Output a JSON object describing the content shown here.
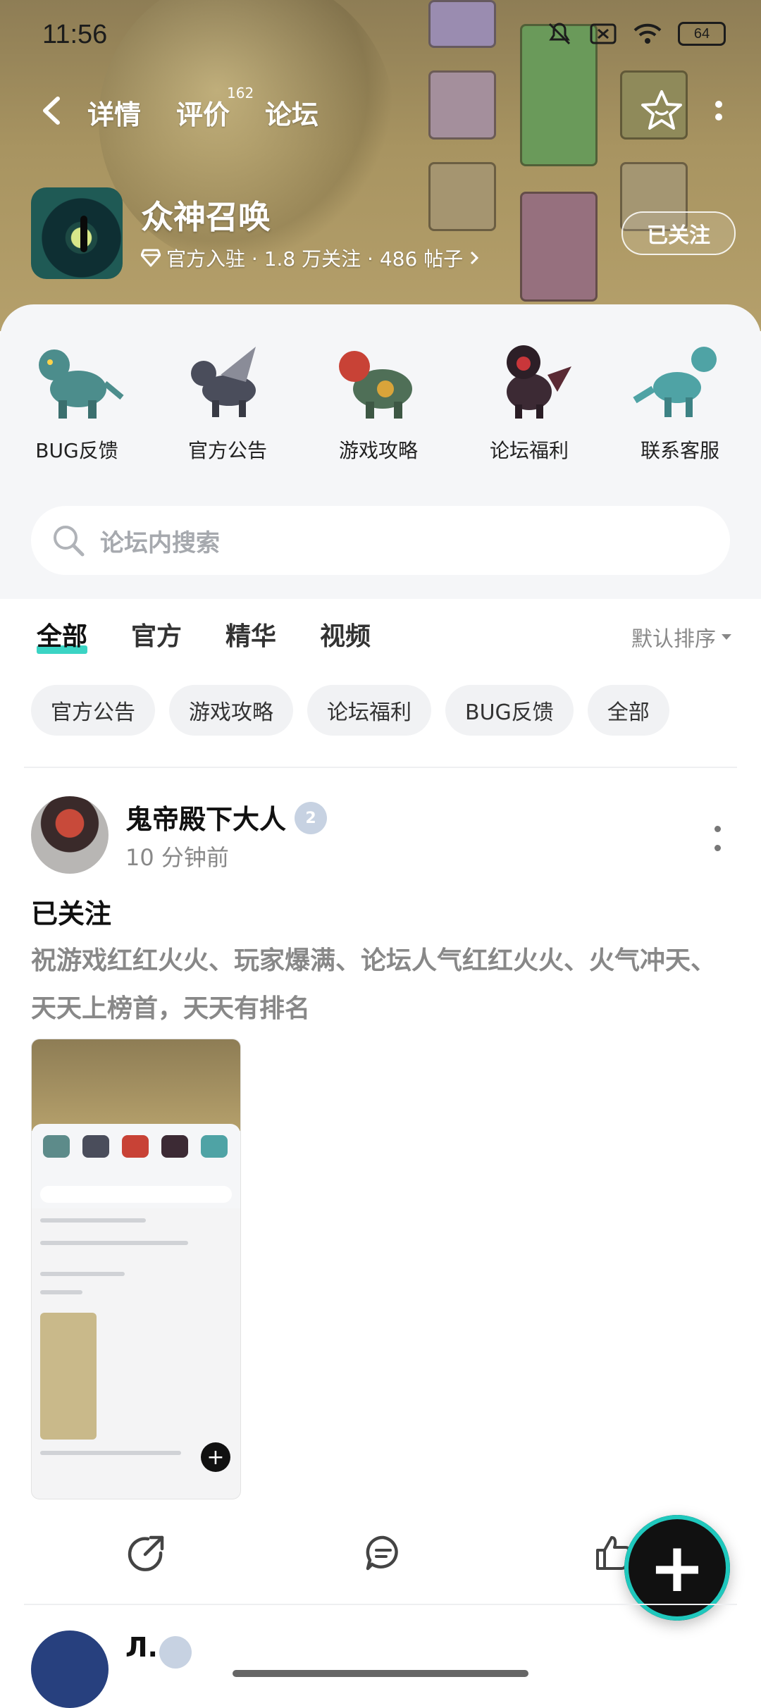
{
  "status_bar": {
    "time": "11:56",
    "battery": "64"
  },
  "nav": {
    "tabs": [
      {
        "label": "详情"
      },
      {
        "label": "评价",
        "badge": "162"
      },
      {
        "label": "论坛"
      }
    ]
  },
  "game": {
    "name": "众神召唤",
    "meta": "官方入驻 · 1.8 万关注 · 486 帖子",
    "follow_label": "已关注"
  },
  "categories": [
    {
      "label": "BUG反馈",
      "color": "#4c8d8c"
    },
    {
      "label": "官方公告",
      "color": "#4a4d5b"
    },
    {
      "label": "游戏攻略",
      "color": "#c84236"
    },
    {
      "label": "论坛福利",
      "color": "#3c2a34"
    },
    {
      "label": "联系客服",
      "color": "#4fa3a5"
    }
  ],
  "search": {
    "placeholder": "论坛内搜索"
  },
  "filter_tabs": [
    "全部",
    "官方",
    "精华",
    "视频"
  ],
  "sort_label": "默认排序",
  "chips": [
    "官方公告",
    "游戏攻略",
    "论坛福利",
    "BUG反馈",
    "全部"
  ],
  "post": {
    "author": "鬼帝殿下大人",
    "level": "2",
    "time": "10 分钟前",
    "title": "已关注",
    "body": "祝游戏红红火火、玩家爆满、论坛人气红红火火、火气冲天、天天上榜首，天天有排名"
  },
  "next_post": {
    "author": "Л."
  },
  "colors": {
    "accent": "#3bd4c4",
    "banner": "#a89461"
  }
}
